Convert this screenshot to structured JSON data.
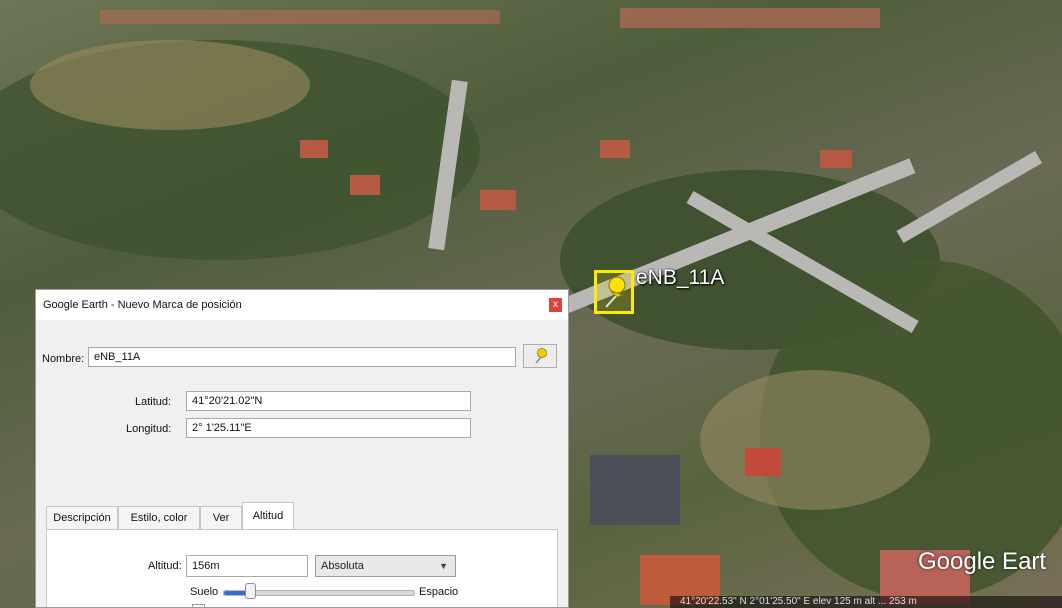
{
  "map": {
    "placemark_label": "eNB_11A",
    "watermark": "Google Eart",
    "status_text": "41°20'22.53\" N    2°01'25.50\" E   elev  125 m    alt  ... 253 m",
    "pin_color": "#ffea00"
  },
  "dialog": {
    "title": "Google Earth - Nuevo Marca de posición",
    "close_label": "x",
    "name_label": "Nombre:",
    "name_value": "eNB_11A",
    "latitude_label": "Latitud:",
    "latitude_value": "41°20'21.02\"N",
    "longitude_label": "Longitud:",
    "longitude_value": "2° 1'25.11\"E",
    "tabs": [
      {
        "label": "Descripción"
      },
      {
        "label": "Estilo, color"
      },
      {
        "label": "Ver"
      },
      {
        "label": "Altitud"
      }
    ],
    "active_tab": "Altitud",
    "altitude_label": "Altitud:",
    "altitude_value": "156m",
    "altitude_mode": "Absoluta",
    "slider_left_label": "Suelo",
    "slider_right_label": "Espacio",
    "slider_level": 0.14
  }
}
